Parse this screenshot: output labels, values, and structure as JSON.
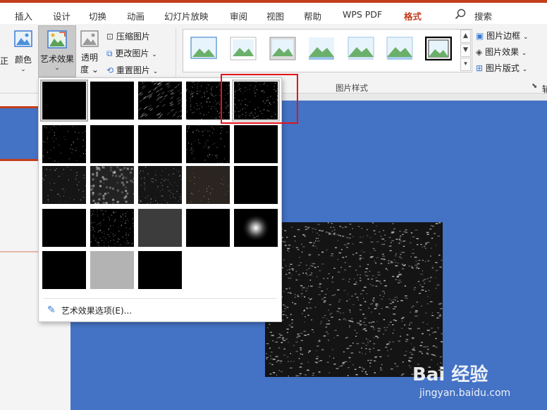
{
  "menu_tabs": [
    {
      "label": "插入"
    },
    {
      "label": "设计"
    },
    {
      "label": "切换"
    },
    {
      "label": "动画"
    },
    {
      "label": "幻灯片放映"
    },
    {
      "label": "审阅"
    },
    {
      "label": "视图"
    },
    {
      "label": "帮助"
    },
    {
      "label": "WPS PDF"
    },
    {
      "label": "格式"
    }
  ],
  "search_label": "搜索",
  "ribbon": {
    "left_cut_label": "正",
    "color_label": "颜色",
    "art_effects_label": "艺术效果",
    "transparency_label_1": "透明",
    "transparency_label_2": "度",
    "compress": "压缩图片",
    "change": "更改图片",
    "reset": "重置图片",
    "picture_border": "图片边框",
    "picture_effects": "图片效果",
    "picture_layout": "图片版式",
    "group_label": "图片样式",
    "right_cut": "辅"
  },
  "dropdown": {
    "option_label": "艺术效果选项(E)...",
    "selected_index": 0,
    "hover_index": 4,
    "effects": [
      "none",
      "solid",
      "lines",
      "noise",
      "texture",
      "sketch",
      "solid",
      "solid",
      "grain",
      "solid",
      "mottle",
      "cells",
      "fine-grain",
      "warm",
      "solid",
      "solid",
      "weave",
      "gray",
      "solid",
      "glow",
      "solid",
      "light-gray",
      "solid"
    ]
  },
  "watermark": {
    "brand": "Bai 经验",
    "url": "jingyan.baidu.com"
  },
  "colors": {
    "accent": "#c43e1c",
    "slide_bg": "#4472c4",
    "highlight": "#e3141b"
  }
}
